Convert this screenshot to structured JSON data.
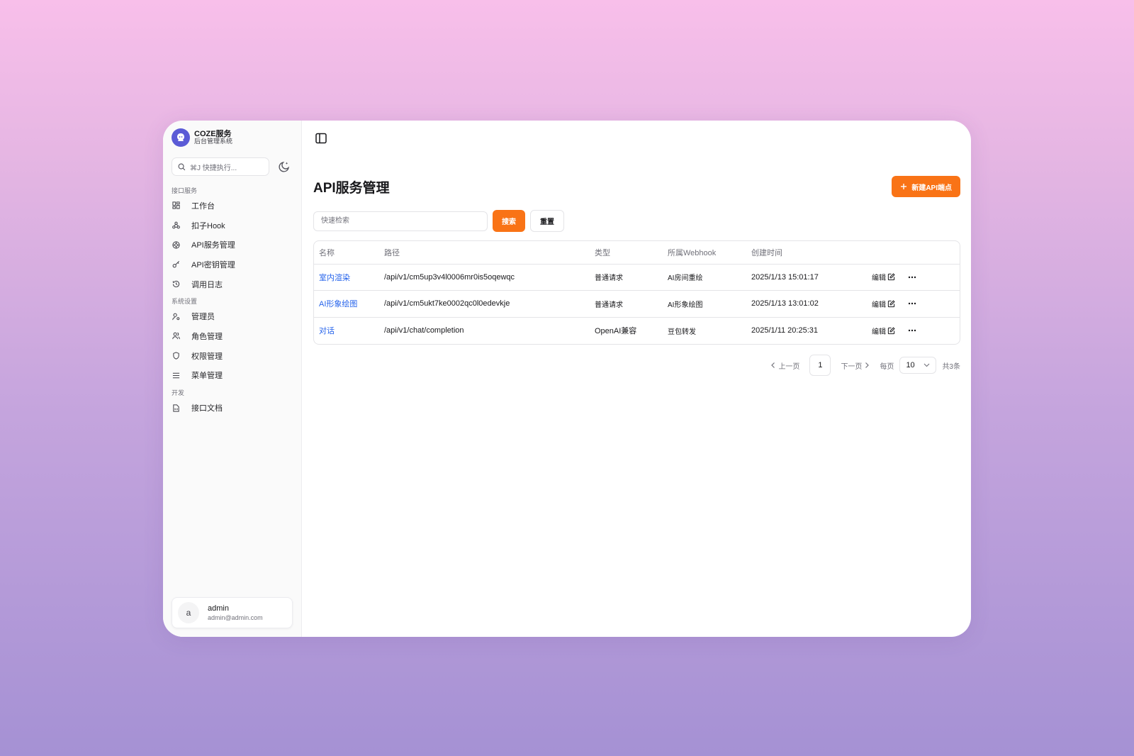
{
  "brand": {
    "title": "COZE服务",
    "subtitle": "后台管理系统"
  },
  "command_search": {
    "placeholder": "⌘J 快捷执行..."
  },
  "sidebar": {
    "groups": [
      {
        "label": "接口服务",
        "items": [
          {
            "label": "工作台",
            "icon": "dashboard-icon"
          },
          {
            "label": "扣子Hook",
            "icon": "webhook-icon"
          },
          {
            "label": "API服务管理",
            "icon": "api-icon"
          },
          {
            "label": "API密钥管理",
            "icon": "key-icon"
          },
          {
            "label": "调用日志",
            "icon": "history-icon"
          }
        ]
      },
      {
        "label": "系统设置",
        "items": [
          {
            "label": "管理员",
            "icon": "user-cog-icon"
          },
          {
            "label": "角色管理",
            "icon": "users-icon"
          },
          {
            "label": "权限管理",
            "icon": "shield-icon"
          },
          {
            "label": "菜单管理",
            "icon": "menu-icon"
          }
        ]
      },
      {
        "label": "开发",
        "items": [
          {
            "label": "接口文档",
            "icon": "file-code-icon"
          }
        ]
      }
    ]
  },
  "user": {
    "initial": "a",
    "name": "admin",
    "email": "admin@admin.com"
  },
  "page": {
    "title": "API服务管理",
    "new_button": "新建API端点"
  },
  "filter": {
    "placeholder": "快速检索",
    "search_label": "搜索",
    "reset_label": "重置"
  },
  "table": {
    "headers": [
      "名称",
      "路径",
      "类型",
      "所属Webhook",
      "创建时间"
    ],
    "edit_label": "编辑",
    "rows": [
      {
        "name": "室内渲染",
        "path": "/api/v1/cm5up3v4l0006mr0is5oqewqc",
        "type": "普通请求",
        "webhook": "AI房间重绘",
        "created": "2025/1/13 15:01:17"
      },
      {
        "name": "AI形象绘图",
        "path": "/api/v1/cm5ukt7ke0002qc0l0edevkje",
        "type": "普通请求",
        "webhook": "AI形象绘图",
        "created": "2025/1/13 13:01:02"
      },
      {
        "name": "对话",
        "path": "/api/v1/chat/completion",
        "type": "OpenAI兼容",
        "webhook": "豆包转发",
        "created": "2025/1/11 20:25:31"
      }
    ]
  },
  "pagination": {
    "prev": "上一页",
    "current": "1",
    "next": "下一页",
    "per_page_label": "每页",
    "page_size": "10",
    "total": "共3条"
  },
  "colors": {
    "accent": "#f97316",
    "brand": "#5b5bd6",
    "link": "#2563eb"
  }
}
